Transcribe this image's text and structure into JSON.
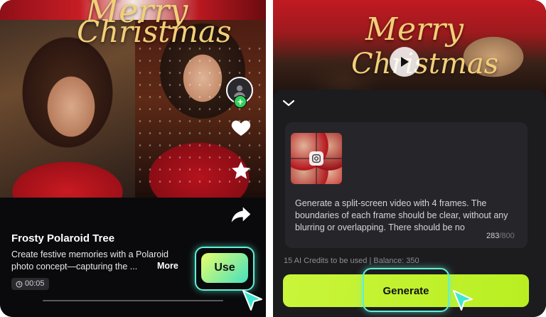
{
  "left_panel": {
    "overlay_title_line1": "Merry",
    "overlay_title_line2": "Christmas",
    "template_title": "Frosty Polaroid Tree",
    "template_description": "Create festive memories with a Polaroid photo concept—capturing the ...",
    "more_label": "More",
    "duration": "00:05",
    "use_button_label": "Use",
    "side_icons": [
      "avatar-icon",
      "plus-icon",
      "heart-icon",
      "star-icon",
      "share-icon"
    ]
  },
  "right_panel": {
    "overlay_title_line1": "Merry",
    "overlay_title_line2": "Christmas",
    "prompt_text": "Generate a split-screen video with 4 frames. The boundaries of each frame should be clear, without any blurring or overlapping. There should be no",
    "char_count": "283",
    "char_max": "/800",
    "credits_text": "15 AI Credits to be used  |  Balance: 350",
    "generate_button_label": "Generate"
  },
  "colors": {
    "accent_gradient_start": "#e8ff6a",
    "accent_gradient_end": "#46e0bf",
    "generate_button": "#c4f232",
    "highlight_outline": "#60f0d6",
    "plus_badge": "#32d15a",
    "title_gold": "#f2cf79"
  }
}
